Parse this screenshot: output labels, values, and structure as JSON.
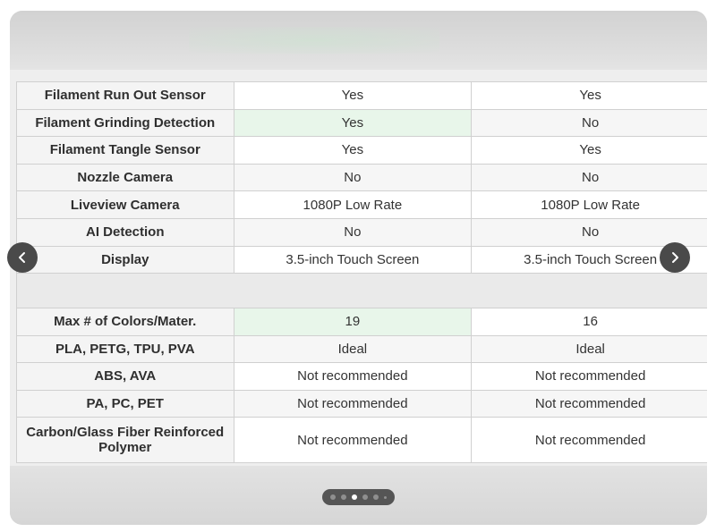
{
  "table_top": {
    "rows": [
      {
        "label": "Filament Run Out Sensor",
        "a": "Yes",
        "b": "Yes",
        "highlight_a": false
      },
      {
        "label": "Filament Grinding Detection",
        "a": "Yes",
        "b": "No",
        "highlight_a": true
      },
      {
        "label": "Filament Tangle Sensor",
        "a": "Yes",
        "b": "Yes",
        "highlight_a": false
      },
      {
        "label": "Nozzle Camera",
        "a": "No",
        "b": "No",
        "highlight_a": false
      },
      {
        "label": "Liveview Camera",
        "a": "1080P Low Rate",
        "b": "1080P Low Rate",
        "highlight_a": false
      },
      {
        "label": "AI Detection",
        "a": "No",
        "b": "No",
        "highlight_a": false
      },
      {
        "label": "Display",
        "a": "3.5-inch Touch Screen",
        "b": "3.5-inch Touch Screen",
        "highlight_a": false
      }
    ]
  },
  "table_bottom": {
    "rows": [
      {
        "label": "Max # of Colors/Mater.",
        "a": "19",
        "b": "16",
        "highlight_a": true
      },
      {
        "label": "PLA, PETG, TPU, PVA",
        "a": "Ideal",
        "b": "Ideal",
        "highlight_a": false
      },
      {
        "label": "ABS, AVA",
        "a": "Not recommended",
        "b": "Not recommended",
        "highlight_a": false
      },
      {
        "label": "PA, PC, PET",
        "a": "Not recommended",
        "b": "Not recommended",
        "highlight_a": false
      },
      {
        "label": "Carbon/Glass Fiber Reinforced Polymer",
        "a": "Not recommended",
        "b": "Not recommended",
        "highlight_a": false
      }
    ]
  },
  "carousel": {
    "prev_icon": "chevron-left-icon",
    "next_icon": "chevron-right-icon",
    "page_count": 6,
    "active_page": 3
  },
  "colors": {
    "highlight": "#e8f6ea",
    "nav_button": "#4a4a4a",
    "dots_bg": "#555555"
  }
}
